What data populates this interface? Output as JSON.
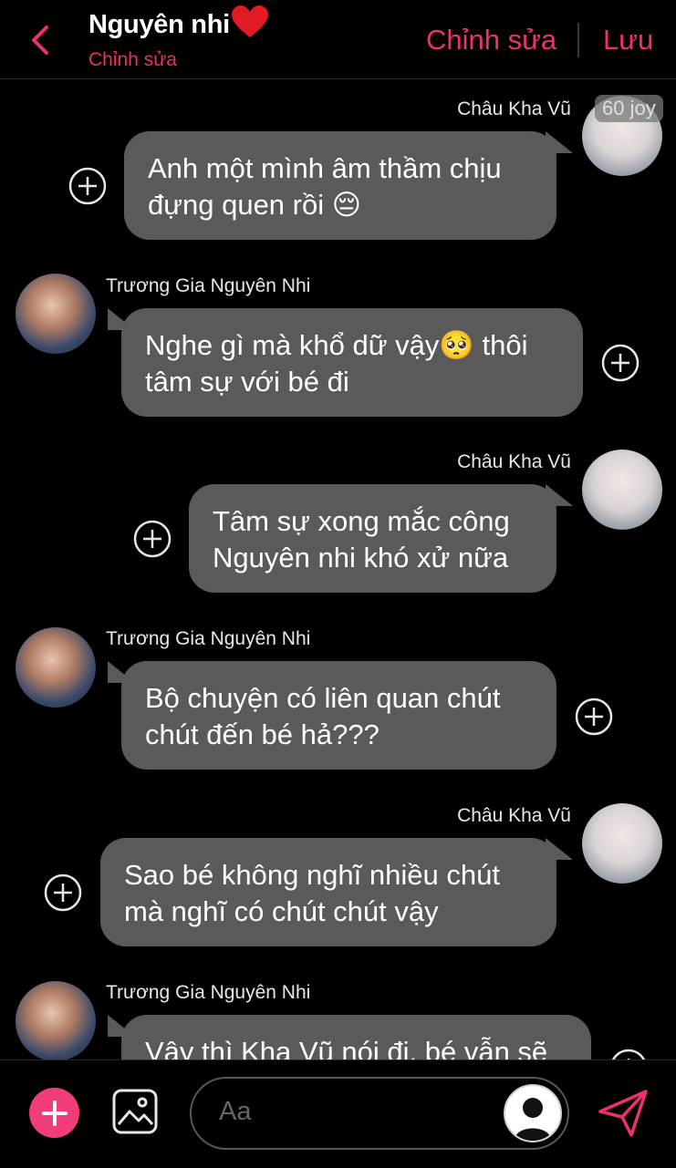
{
  "header": {
    "title": "Nguyên nhi",
    "subtitle": "Chỉnh sửa",
    "edit_label": "Chỉnh sửa",
    "save_label": "Lưu"
  },
  "badge": "60 joy",
  "messages": [
    {
      "sender": "Châu Kha Vũ",
      "side": "right",
      "lines": [
        "Anh một mình âm thầm chịu",
        "đựng quen rồi 😔"
      ]
    },
    {
      "sender": "Trương Gia Nguyên Nhi",
      "side": "left",
      "lines": [
        "Nghe gì mà khổ dữ vậy🥺 thôi",
        "tâm sự với bé đi"
      ]
    },
    {
      "sender": "Châu Kha Vũ",
      "side": "right",
      "lines": [
        "Tâm sự xong mắc công",
        "Nguyên nhi khó xử nữa"
      ]
    },
    {
      "sender": "Trương Gia Nguyên Nhi",
      "side": "left",
      "lines": [
        "Bộ chuyện có liên quan chút",
        "chút đến bé hả???"
      ]
    },
    {
      "sender": "Châu Kha Vũ",
      "side": "right",
      "lines": [
        "Sao bé không nghĩ nhiều chút",
        "mà nghĩ có chút chút vậy"
      ]
    },
    {
      "sender": "Trương Gia Nguyên Nhi",
      "side": "left",
      "lines": [
        "Vậy thì Kha Vũ nói đi, bé vẫn sẽ"
      ]
    }
  ],
  "composer": {
    "placeholder": "Aa"
  },
  "colors": {
    "accent": "#f0306a",
    "bubble": "#5a5a5a",
    "background": "#000000"
  },
  "icons": [
    "chevron-left-icon",
    "heart-icon",
    "plus-circle-icon",
    "image-icon",
    "profile-icon",
    "send-icon"
  ]
}
